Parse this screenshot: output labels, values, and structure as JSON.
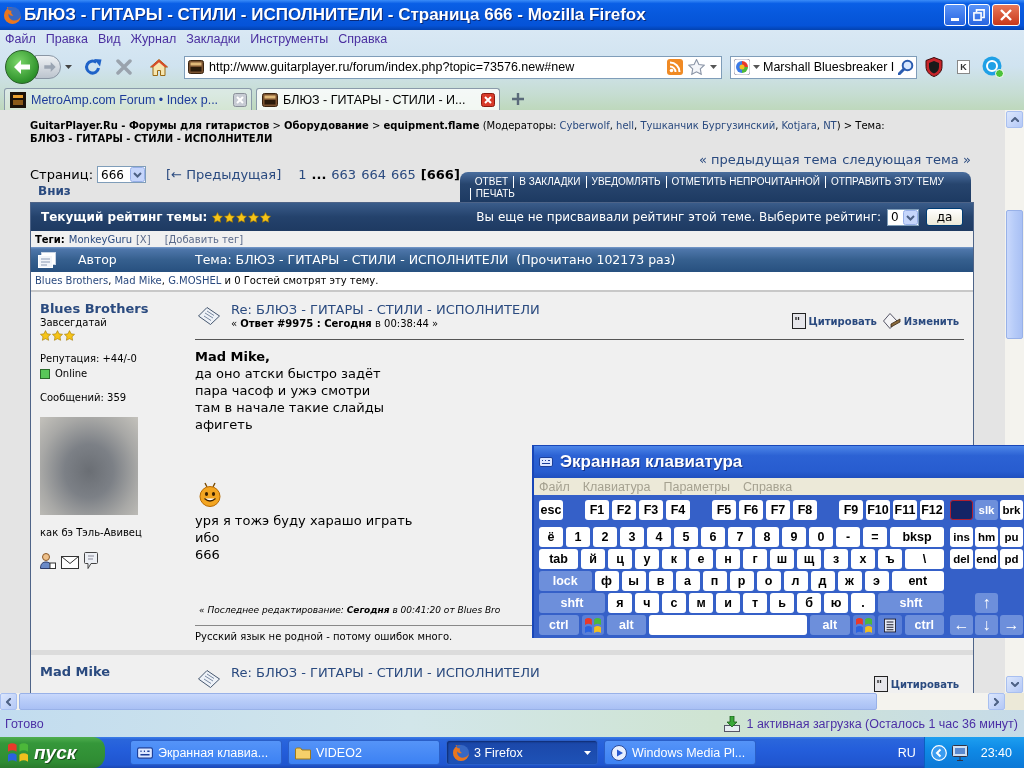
{
  "window": {
    "title": "БЛЮЗ - ГИТАРЫ - СТИЛИ - ИСПОЛНИТЕЛИ - Страница 666 - Mozilla Firefox"
  },
  "menu": [
    "Файл",
    "Правка",
    "Вид",
    "Журнал",
    "Закладки",
    "Инструменты",
    "Справка"
  ],
  "toolbar": {
    "url": "http://www.guitarplayer.ru/forum/index.php?topic=73576.new#new",
    "search": "Marshall Bluesbreaker I",
    "extension_label": "K"
  },
  "tabs": [
    {
      "label": "MetroAmp.com Forum • Index p...",
      "kind": "tile",
      "selected": false
    },
    {
      "label": "БЛЮЗ - ГИТАРЫ - СТИЛИ - И...",
      "kind": "amp",
      "selected": true
    }
  ],
  "breadcrumb": [
    {
      "kind": "link",
      "text": "GuitarPlayer.Ru - Форумы для гитаристов"
    },
    {
      "kind": "text",
      "text": " > "
    },
    {
      "kind": "link",
      "text": "Оборудование"
    },
    {
      "kind": "text",
      "text": " > "
    },
    {
      "kind": "link",
      "text": "equipment.flame"
    },
    {
      "kind": "text",
      "text": " (Модераторы: "
    },
    {
      "kind": "user",
      "text": "Cyberwolf"
    },
    {
      "kind": "text",
      "text": ", "
    },
    {
      "kind": "user",
      "text": "hell"
    },
    {
      "kind": "text",
      "text": ", "
    },
    {
      "kind": "user",
      "text": "Тушканчик Бургузинский"
    },
    {
      "kind": "text",
      "text": ", "
    },
    {
      "kind": "user",
      "text": "Kotjara"
    },
    {
      "kind": "text",
      "text": ", "
    },
    {
      "kind": "user",
      "text": "NT"
    },
    {
      "kind": "text",
      "text": ") > Тема: "
    },
    {
      "kind": "link",
      "text": "БЛЮЗ - ГИТАРЫ - СТИЛИ - ИСПОЛНИТЕЛИ"
    }
  ],
  "topic_nav": {
    "previous": "« предыдущая тема",
    "next": "следующая тема »"
  },
  "pagination": {
    "label": "Страниц:",
    "select": "666",
    "previous": "[← Предыдущая]",
    "first_pages": [
      {
        "label": "1",
        "selected": false
      }
    ],
    "gap": "...",
    "last_pages": [
      {
        "label": "663",
        "selected": false
      },
      {
        "label": "664",
        "selected": false
      },
      {
        "label": "665",
        "selected": false
      },
      {
        "label": "[666]",
        "selected": true
      }
    ],
    "down": "Вниз"
  },
  "actions": [
    "ОТВЕТ",
    "В ЗАКЛАДКИ",
    "УВЕДОМЛЯТЬ",
    "ОТМЕТИТЬ НЕПРОЧИТАННОЙ",
    "ОТПРАВИТЬ ЭТУ ТЕМУ",
    "ПЕЧАТЬ"
  ],
  "rating": {
    "label": "Текущий рейтинг темы:",
    "stars": 5,
    "prompt": "Вы еще не присваивали рейтинг этой теме. Выберите рейтинг:",
    "choice": "0",
    "submit": "да"
  },
  "tags": {
    "label": "Теги:",
    "items": [
      {
        "label": "MonkeyGuru",
        "remove": "[X]"
      }
    ],
    "add": "[Добавить тег]"
  },
  "topic_header": {
    "author": "Автор",
    "topic": "Тема: БЛЮЗ - ГИТАРЫ - СТИЛИ - ИСПОЛНИТЕЛИ  (Прочитано 102173 раз)"
  },
  "viewers": [
    {
      "kind": "user",
      "text": "Blues Brothers"
    },
    {
      "kind": "text",
      "text": ", "
    },
    {
      "kind": "user",
      "text": "Mad Mike"
    },
    {
      "kind": "text",
      "text": ", "
    },
    {
      "kind": "user",
      "text": "G.MOSHEL"
    },
    {
      "kind": "text",
      "text": " и 0 Гостей смотрят эту тему."
    }
  ],
  "posts": [
    {
      "author": "Blues Brothers",
      "rank": "Завсегдатай",
      "stars": 3,
      "reputation": "Репутация: +44/-0",
      "online": true,
      "status": "Online",
      "post_count": "Сообщений: 359",
      "avatar": true,
      "personal_text": "как бэ Тэль-Авивец",
      "profile_links": true,
      "title": "Re: БЛЮЗ - ГИТАРЫ - СТИЛИ - ИСПОЛНИТЕЛИ",
      "meta": "« **Ответ #9975 : Сегодня** в 00:38:44 »",
      "actions": [
        {
          "label": "Цитировать",
          "kind": "quote"
        },
        {
          "label": "Изменить",
          "kind": "edit"
        }
      ],
      "body": [
        {
          "kind": "bold",
          "text": "Mad Mike,"
        },
        {
          "kind": "text",
          "text": "да оно атски быстро задёт"
        },
        {
          "kind": "text",
          "text": "пара часоф и ужэ смотри"
        },
        {
          "kind": "text",
          "text": "там в начале такие слайды"
        },
        {
          "kind": "text",
          "text": "афигеть"
        },
        {
          "kind": "smiley"
        },
        {
          "kind": "text",
          "text": "уря я тожэ буду харашо играть"
        },
        {
          "kind": "text",
          "text": "ибо"
        },
        {
          "kind": "text",
          "text": "666"
        }
      ],
      "edited": "« Последнее редактирование: **Сегодня** в 00:41:20 от Blues Bro",
      "signature": "Русский язык не родной - потому ошибок много."
    },
    {
      "author": "Mad Mike",
      "title": "Re: БЛЮЗ - ГИТАРЫ - СТИЛИ - ИСПОЛНИТЕЛИ",
      "actions": [
        {
          "label": "Цитировать",
          "kind": "quote"
        }
      ]
    }
  ],
  "keyboard": {
    "title": "Экранная клавиатура",
    "menu": [
      "Файл",
      "Клавиатура",
      "Параметры",
      "Справка"
    ],
    "function_row": [
      {
        "keys": [
          {
            "label": "esc",
            "kind": "char"
          }
        ]
      },
      {
        "keys": [
          {
            "label": "F1",
            "kind": "char"
          },
          {
            "label": "F2",
            "kind": "char"
          },
          {
            "label": "F3",
            "kind": "char"
          },
          {
            "label": "F4",
            "kind": "char"
          }
        ]
      },
      {
        "keys": [
          {
            "label": "F5",
            "kind": "char"
          },
          {
            "label": "F6",
            "kind": "char"
          },
          {
            "label": "F7",
            "kind": "char"
          },
          {
            "label": "F8",
            "kind": "char"
          }
        ]
      },
      {
        "keys": [
          {
            "label": "F9",
            "kind": "char"
          },
          {
            "label": "F10",
            "kind": "char"
          },
          {
            "label": "F11",
            "kind": "char"
          },
          {
            "label": "F12",
            "kind": "char"
          }
        ]
      }
    ],
    "rows": [
      {
        "keys": [
          {
            "label": "ё",
            "kind": "char"
          },
          {
            "label": "1",
            "kind": "char"
          },
          {
            "label": "2",
            "kind": "char"
          },
          {
            "label": "3",
            "kind": "char"
          },
          {
            "label": "4",
            "kind": "char"
          },
          {
            "label": "5",
            "kind": "char"
          },
          {
            "label": "6",
            "kind": "char"
          },
          {
            "label": "7",
            "kind": "char"
          },
          {
            "label": "8",
            "kind": "char"
          },
          {
            "label": "9",
            "kind": "char"
          },
          {
            "label": "0",
            "kind": "char"
          },
          {
            "label": "-",
            "kind": "char"
          },
          {
            "label": "=",
            "kind": "char"
          },
          {
            "label": "bksp",
            "kind": "wide"
          }
        ]
      },
      {
        "keys": [
          {
            "label": "tab",
            "kind": "wide"
          },
          {
            "label": "й",
            "kind": "char"
          },
          {
            "label": "ц",
            "kind": "char"
          },
          {
            "label": "у",
            "kind": "char"
          },
          {
            "label": "к",
            "kind": "char"
          },
          {
            "label": "е",
            "kind": "char"
          },
          {
            "label": "н",
            "kind": "char"
          },
          {
            "label": "г",
            "kind": "char"
          },
          {
            "label": "ш",
            "kind": "char"
          },
          {
            "label": "щ",
            "kind": "char"
          },
          {
            "label": "з",
            "kind": "char"
          },
          {
            "label": "х",
            "kind": "char"
          },
          {
            "label": "ъ",
            "kind": "char"
          },
          {
            "label": "\\",
            "kind": "wide"
          }
        ]
      },
      {
        "keys": [
          {
            "label": "lock",
            "kind": "mod"
          },
          {
            "label": "ф",
            "kind": "char"
          },
          {
            "label": "ы",
            "kind": "char"
          },
          {
            "label": "в",
            "kind": "char"
          },
          {
            "label": "а",
            "kind": "char"
          },
          {
            "label": "п",
            "kind": "char"
          },
          {
            "label": "р",
            "kind": "char"
          },
          {
            "label": "о",
            "kind": "char"
          },
          {
            "label": "л",
            "kind": "char"
          },
          {
            "label": "д",
            "kind": "char"
          },
          {
            "label": "ж",
            "kind": "char"
          },
          {
            "label": "э",
            "kind": "char"
          },
          {
            "label": "ent",
            "kind": "wide"
          }
        ]
      },
      {
        "keys": [
          {
            "label": "shft",
            "kind": "mod"
          },
          {
            "label": "я",
            "kind": "char"
          },
          {
            "label": "ч",
            "kind": "char"
          },
          {
            "label": "с",
            "kind": "char"
          },
          {
            "label": "м",
            "kind": "char"
          },
          {
            "label": "и",
            "kind": "char"
          },
          {
            "label": "т",
            "kind": "char"
          },
          {
            "label": "ь",
            "kind": "char"
          },
          {
            "label": "б",
            "kind": "char"
          },
          {
            "label": "ю",
            "kind": "char"
          },
          {
            "label": ".",
            "kind": "char"
          },
          {
            "label": "shft",
            "kind": "mod"
          }
        ]
      },
      {
        "keys": [
          {
            "label": "ctrl",
            "kind": "mod"
          },
          {
            "kind": "win"
          },
          {
            "label": "alt",
            "kind": "mod"
          },
          {
            "kind": "space"
          },
          {
            "label": "alt",
            "kind": "mod"
          },
          {
            "kind": "win"
          },
          {
            "kind": "menu"
          },
          {
            "label": "ctrl",
            "kind": "mod"
          }
        ]
      }
    ],
    "nav_rows": [
      {
        "keys": [
          {
            "kind": "active"
          },
          {
            "label": "slk",
            "kind": "mod"
          },
          {
            "label": "brk",
            "kind": "char"
          }
        ]
      },
      {
        "keys": [
          {
            "label": "ins",
            "kind": "char"
          },
          {
            "label": "hm",
            "kind": "char"
          },
          {
            "label": "pu",
            "kind": "char"
          }
        ]
      },
      {
        "keys": [
          {
            "label": "del",
            "kind": "char"
          },
          {
            "label": "end",
            "kind": "char"
          },
          {
            "label": "pd",
            "kind": "char"
          }
        ]
      }
    ],
    "arrows": [
      {
        "keys": [
          {
            "label": "↑",
            "kind": "mod"
          }
        ]
      },
      {
        "keys": [
          {
            "label": "←",
            "kind": "mod"
          },
          {
            "label": "↓",
            "kind": "mod"
          },
          {
            "label": "→",
            "kind": "mod"
          }
        ]
      }
    ]
  },
  "status_bar": {
    "text": "Готово",
    "download": "1 активная загрузка (Осталось 1 час 36 минут)"
  },
  "taskbar": {
    "start": "пуск",
    "buttons": [
      {
        "label": "Экранная клавиа...",
        "kind": "keyboard",
        "grouped": false,
        "selected": false
      },
      {
        "label": "VIDEO2",
        "kind": "folder",
        "grouped": false,
        "selected": false
      },
      {
        "label": "3 Firefox",
        "kind": "browser",
        "grouped": true,
        "selected": true
      },
      {
        "label": "Windows Media Pl...",
        "kind": "player",
        "grouped": false,
        "selected": false
      }
    ],
    "language": "RU",
    "clock": "23:40"
  }
}
